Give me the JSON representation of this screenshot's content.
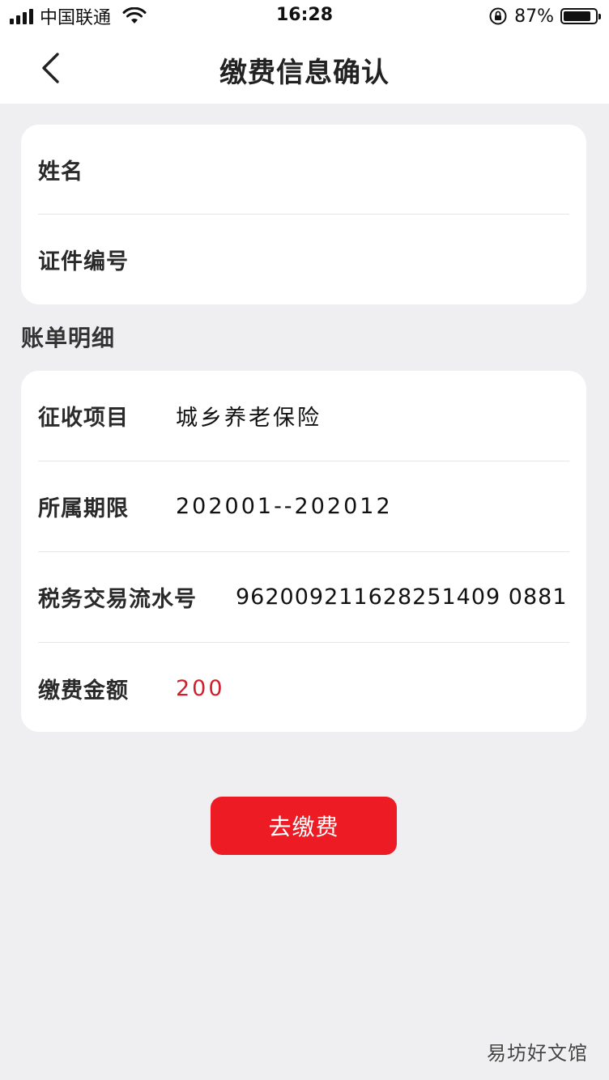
{
  "status_bar": {
    "carrier": "中国联通",
    "time": "16:28",
    "battery_percent": "87%",
    "battery_level": 0.87,
    "icons": [
      "signal-icon",
      "wifi-icon",
      "rotation-lock-icon",
      "battery-icon"
    ]
  },
  "nav": {
    "back_icon": "chevron-left-icon",
    "title": "缴费信息确认"
  },
  "identity": {
    "name_label": "姓名",
    "name_value": "",
    "id_label": "证件编号",
    "id_value": ""
  },
  "bill": {
    "section_title": "账单明细",
    "rows": [
      {
        "label": "征收项目",
        "value": "城乡养老保险"
      },
      {
        "label": "所属期限",
        "value": "202001--202012"
      },
      {
        "label": "税务交易流水号",
        "value": "962009211628251409 0881"
      },
      {
        "label": "缴费金额",
        "value": "200"
      }
    ]
  },
  "actions": {
    "pay_label": "去缴费"
  },
  "watermark": "易坊好文馆",
  "colors": {
    "accent": "#ed1c24",
    "amount": "#d0202c",
    "background": "#efeff1",
    "card": "#ffffff"
  }
}
